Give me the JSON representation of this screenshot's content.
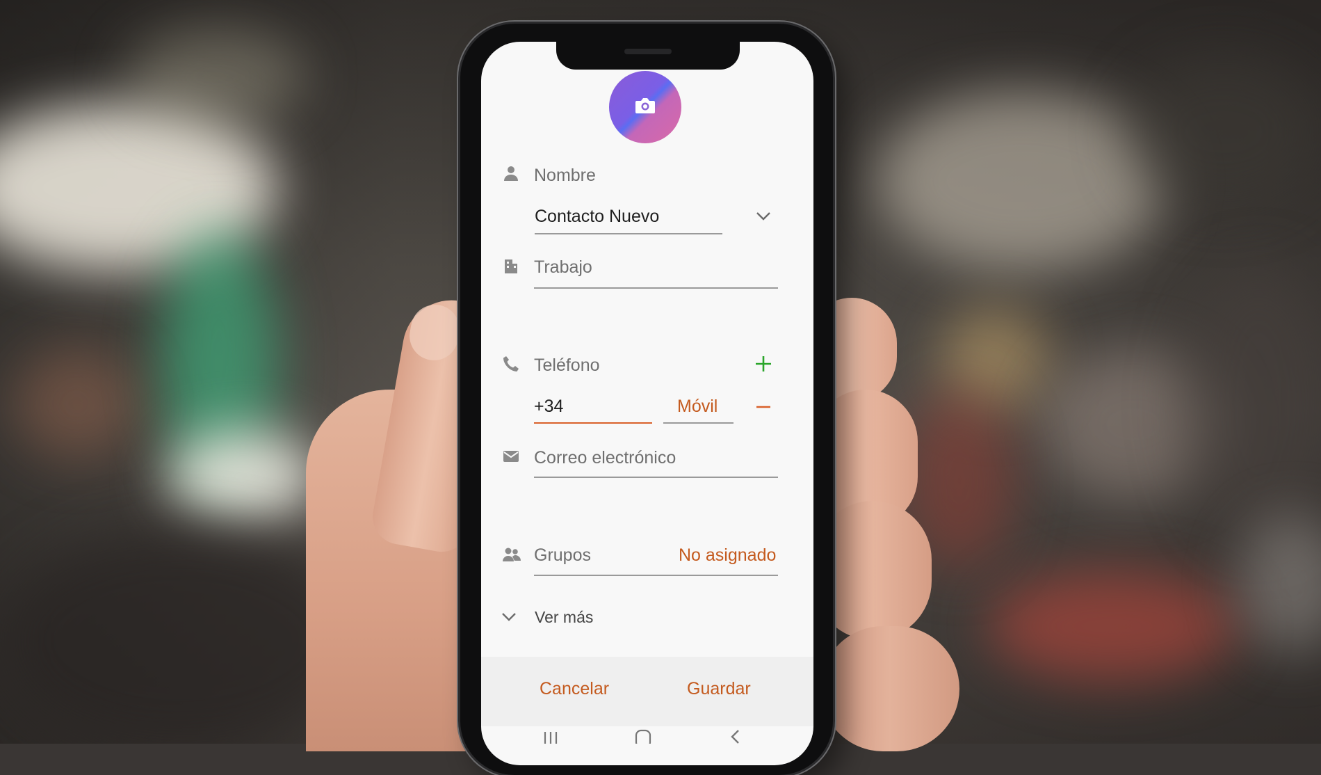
{
  "form": {
    "name_label": "Nombre",
    "name_value": "Contacto Nuevo",
    "work_label": "Trabajo",
    "phone_label": "Teléfono",
    "phone_value": "+34",
    "phone_type": "Móvil",
    "email_label": "Correo electrónico",
    "groups_label": "Grupos",
    "groups_value": "No asignado",
    "more_label": "Ver más"
  },
  "actions": {
    "cancel": "Cancelar",
    "save": "Guardar"
  },
  "icons": {
    "photo": "camera-icon",
    "name": "person-icon",
    "work": "building-icon",
    "phone": "phone-icon",
    "add_phone": "plus-icon",
    "remove_phone": "minus-icon",
    "email": "envelope-icon",
    "groups": "people-icon",
    "expand_name": "chevron-down-icon",
    "more": "chevron-down-icon",
    "nav_recents": "recents-icon",
    "nav_home": "home-icon",
    "nav_back": "back-icon"
  },
  "colors": {
    "accent": "#c45a1e",
    "add": "#2aa52a",
    "screen_bg": "#f8f8f8"
  }
}
